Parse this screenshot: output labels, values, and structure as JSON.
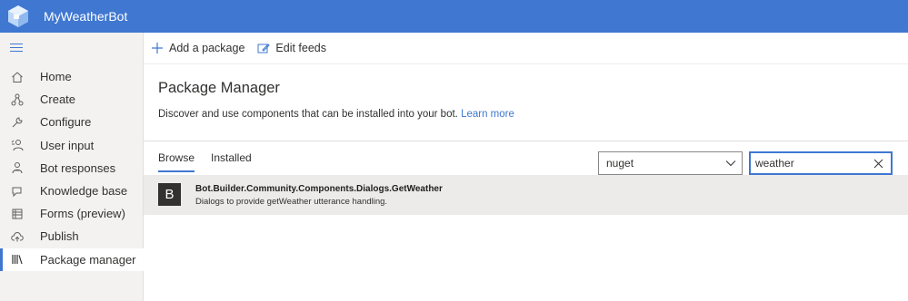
{
  "app": {
    "title": "MyWeatherBot"
  },
  "sidebar": {
    "items": [
      {
        "label": "Home",
        "icon": "home-icon"
      },
      {
        "label": "Create",
        "icon": "create-icon"
      },
      {
        "label": "Configure",
        "icon": "wrench-icon"
      },
      {
        "label": "User input",
        "icon": "user-input-icon"
      },
      {
        "label": "Bot responses",
        "icon": "bot-icon"
      },
      {
        "label": "Knowledge base",
        "icon": "chat-icon"
      },
      {
        "label": "Forms (preview)",
        "icon": "table-icon"
      },
      {
        "label": "Publish",
        "icon": "cloud-upload-icon"
      },
      {
        "label": "Package manager",
        "icon": "library-icon",
        "active": true
      }
    ]
  },
  "toolbar": {
    "add_label": "Add a package",
    "edit_label": "Edit feeds"
  },
  "page": {
    "title": "Package Manager",
    "description": "Discover and use components that can be installed into your bot.",
    "learn_more": "Learn more"
  },
  "tabs": {
    "browse": "Browse",
    "installed": "Installed"
  },
  "feed": {
    "selected": "nuget"
  },
  "search": {
    "value": "weather"
  },
  "results": [
    {
      "icon_letter": "B",
      "name": "Bot.Builder.Community.Components.Dialogs.GetWeather",
      "description": "Dialogs to provide getWeather utterance handling."
    }
  ],
  "colors": {
    "accent": "#3f77d1",
    "sidebar_bg": "#f3f2f1",
    "selected_row": "#edebe9"
  }
}
